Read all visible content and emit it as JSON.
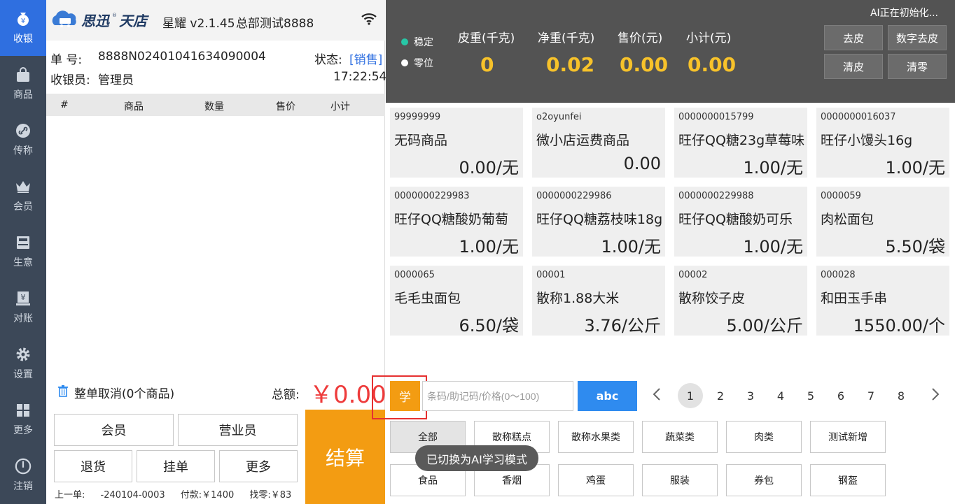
{
  "nav": {
    "items": [
      {
        "label": "收银",
        "icon": "cashier-icon"
      },
      {
        "label": "商品",
        "icon": "bag-icon"
      },
      {
        "label": "传称",
        "icon": "link-icon"
      },
      {
        "label": "会员",
        "icon": "crown-icon"
      },
      {
        "label": "生意",
        "icon": "register-icon"
      },
      {
        "label": "对账",
        "icon": "ledger-icon"
      },
      {
        "label": "设置",
        "icon": "gear-icon"
      },
      {
        "label": "更多",
        "icon": "grid-icon"
      },
      {
        "label": "注销",
        "icon": "power-icon"
      }
    ],
    "active_color": "#2f6fe0"
  },
  "header": {
    "logo": "思迅 天店",
    "version": "星耀 v2.1.45",
    "store": "总部测试8888"
  },
  "order": {
    "number_label": "单 号:",
    "number": "8888N02401041634090004",
    "status_label": "状态:",
    "status": "[销售]",
    "cashier_label": "收银员:",
    "cashier": "管理员",
    "time": "17:22:54",
    "columns": [
      "#",
      "商品",
      "数量",
      "售价",
      "小计"
    ],
    "cancel_label": "整单取消(0个商品)",
    "total_label": "总额:",
    "total": "￥0.00"
  },
  "actions": {
    "member": "会员",
    "staff": "营业员",
    "refund": "退货",
    "hold": "挂单",
    "more": "更多",
    "checkout": "结算"
  },
  "last_order": {
    "prefix": "上一单:",
    "number": "-240104-0003",
    "paid": "付款:￥1400",
    "change": "找零:￥83"
  },
  "scale": {
    "ai_status": "AI正在初始化...",
    "stable": "稳定",
    "zero": "零位",
    "metrics": [
      {
        "label": "皮重(千克)",
        "value": "0"
      },
      {
        "label": "净重(千克)",
        "value": "0.02"
      },
      {
        "label": "售价(元)",
        "value": "0.00"
      },
      {
        "label": "小计(元)",
        "value": "0.00"
      }
    ],
    "buttons": {
      "tare": "去皮",
      "digital_tare": "数字去皮",
      "clear_tare": "清皮",
      "zero": "清零"
    },
    "stable_color": "#27c7a6",
    "value_color": "#f7c22a"
  },
  "products": [
    {
      "code": "99999999",
      "name": "无码商品",
      "price": "0.00/无"
    },
    {
      "code": "o2oyunfei",
      "name": "微小店运费商品",
      "price": "0.00"
    },
    {
      "code": "0000000015799",
      "name": "旺仔QQ糖23g草莓味",
      "price": "1.00/无"
    },
    {
      "code": "0000000016037",
      "name": "旺仔小馒头16g",
      "price": "1.00/无"
    },
    {
      "code": "0000000229983",
      "name": "旺仔QQ糖酸奶葡萄",
      "price": "1.00/无"
    },
    {
      "code": "0000000229986",
      "name": "旺仔QQ糖荔枝味18g",
      "price": "1.00/无"
    },
    {
      "code": "0000000229988",
      "name": "旺仔QQ糖酸奶可乐",
      "price": "1.00/无"
    },
    {
      "code": "0000059",
      "name": "肉松面包",
      "price": "5.50/袋"
    },
    {
      "code": "0000065",
      "name": "毛毛虫面包",
      "price": "6.50/袋"
    },
    {
      "code": "00001",
      "name": "散称1.88大米",
      "price": "3.76/公斤"
    },
    {
      "code": "00002",
      "name": "散称饺子皮",
      "price": "5.00/公斤"
    },
    {
      "code": "000028",
      "name": "和田玉手串",
      "price": "1550.00/个"
    }
  ],
  "search": {
    "learn_label": "学",
    "placeholder": "条码/助记码/价格(0～100)",
    "keyboard_label": "abc"
  },
  "pager": {
    "pages": [
      "1",
      "2",
      "3",
      "4",
      "5",
      "6",
      "7",
      "8"
    ],
    "current": "1"
  },
  "categories": [
    "全部",
    "散称糕点",
    "散称水果类",
    "蔬菜类",
    "肉类",
    "测试新增",
    "食品",
    "香烟",
    "鸡蛋",
    "服装",
    "券包",
    "钢盔"
  ],
  "toast": "已切换为AI学习模式"
}
